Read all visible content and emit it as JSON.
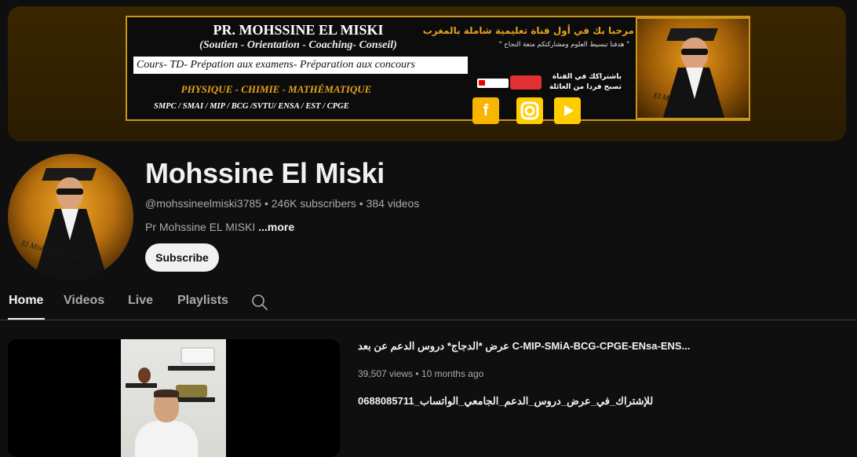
{
  "banner": {
    "title": "PR. MOHSSINE EL MISKI",
    "subtitle": "(Soutien - Orientation - Coaching- Conseil)",
    "services": "Cours- TD- Prépation aux examens- Préparation aux concours",
    "subjects": "PHYSIQUE - CHIMIE - MATHÉMATIQUE",
    "tracks": "SMPC / SMAI / MIP / BCG /SVTU/ ENSA / EST / CPGE",
    "arabic_welcome": "مرحبا بك في أول قناة تعليمية شاملة بالمغرب",
    "arabic_slogan": "\" هدفنا تبسيط العلوم ومشاركتكم متعة النجاح \"",
    "arabic_subscribe_line1": "باشتراكك في القناة",
    "arabic_subscribe_line2": "تصبح فردا من العائلة",
    "photo_label": "El Miski Mohssine",
    "social_icons": [
      "facebook-icon",
      "instagram-icon",
      "youtube-icon"
    ],
    "colors": {
      "gold": "#e8a21b",
      "border": "#c9951a"
    }
  },
  "channel": {
    "avatar_label": "El Miski Mohssine",
    "name": "Mohssine El Miski",
    "handle": "@mohssineelmiski3785",
    "subscribers": "246K subscribers",
    "videos": "384 videos",
    "meta_sep": " • ",
    "description": "Pr Mohssine EL MISKI",
    "more_label": "...more",
    "subscribe_label": "Subscribe"
  },
  "tabs": [
    {
      "label": "Home",
      "active": true
    },
    {
      "label": "Videos",
      "active": false
    },
    {
      "label": "Live",
      "active": false
    },
    {
      "label": "Playlists",
      "active": false
    }
  ],
  "featured_video": {
    "title": "عرض *الدجاج* دروس الدعم عن بعد C-MIP-SMiA-BCG-CPGE-ENsa-ENS...",
    "views": "39,507 views",
    "age": "10 months ago",
    "description": "للإشتراك_في_عرض_دروس_الدعم_الجامعي_الواتساب_0688085711"
  },
  "theme": {
    "background": "#0f0f0f",
    "text": "#f1f1f1",
    "muted": "#aaaaaa"
  }
}
